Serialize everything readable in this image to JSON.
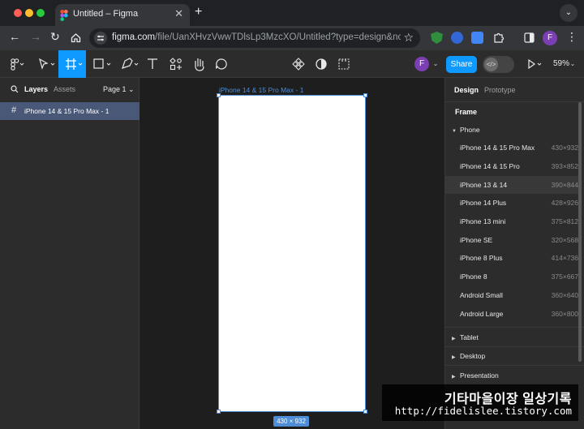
{
  "browser": {
    "tab_title": "Untitled – Figma",
    "tab_close": "✕",
    "new_tab": "+",
    "tab_menu": "⌄",
    "url_host": "figma.com",
    "url_path": "/file/UanXHvzVwwTDlsLp3MzcXO/Untitled?type=design&node...",
    "profile_initial": "F"
  },
  "figma_toolbar": {
    "share_label": "Share",
    "zoom_level": "59%",
    "user_initial": "F"
  },
  "left_panel": {
    "tabs": [
      "Layers",
      "Assets"
    ],
    "page_selector": "Page 1 ⌄",
    "layers": [
      {
        "name": "iPhone 14 & 15 Pro Max - 1"
      }
    ]
  },
  "canvas": {
    "frame_label": "iPhone 14 & 15 Pro Max - 1",
    "frame_size": "430 × 932"
  },
  "right_panel": {
    "tabs": [
      "Design",
      "Prototype"
    ],
    "section_title": "Frame",
    "groups": {
      "phone": "Phone",
      "tablet": "Tablet",
      "desktop": "Desktop",
      "presentation": "Presentation"
    },
    "presets": [
      {
        "name": "iPhone 14 & 15 Pro Max",
        "size": "430×932"
      },
      {
        "name": "iPhone 14 & 15 Pro",
        "size": "393×852"
      },
      {
        "name": "iPhone 13 & 14",
        "size": "390×844"
      },
      {
        "name": "iPhone 14 Plus",
        "size": "428×926"
      },
      {
        "name": "iPhone 13 mini",
        "size": "375×812"
      },
      {
        "name": "iPhone SE",
        "size": "320×568"
      },
      {
        "name": "iPhone 8 Plus",
        "size": "414×736"
      },
      {
        "name": "iPhone 8",
        "size": "375×667"
      },
      {
        "name": "Android Small",
        "size": "360×640"
      },
      {
        "name": "Android Large",
        "size": "360×800"
      }
    ]
  },
  "watermark": {
    "line1": "기타마을이장 일상기록",
    "line2": "http://fidelislee.tistory.com"
  },
  "colors": {
    "accent": "#0d99ff",
    "selection": "#4f8ed6",
    "layer_highlight": "#4a5878"
  }
}
